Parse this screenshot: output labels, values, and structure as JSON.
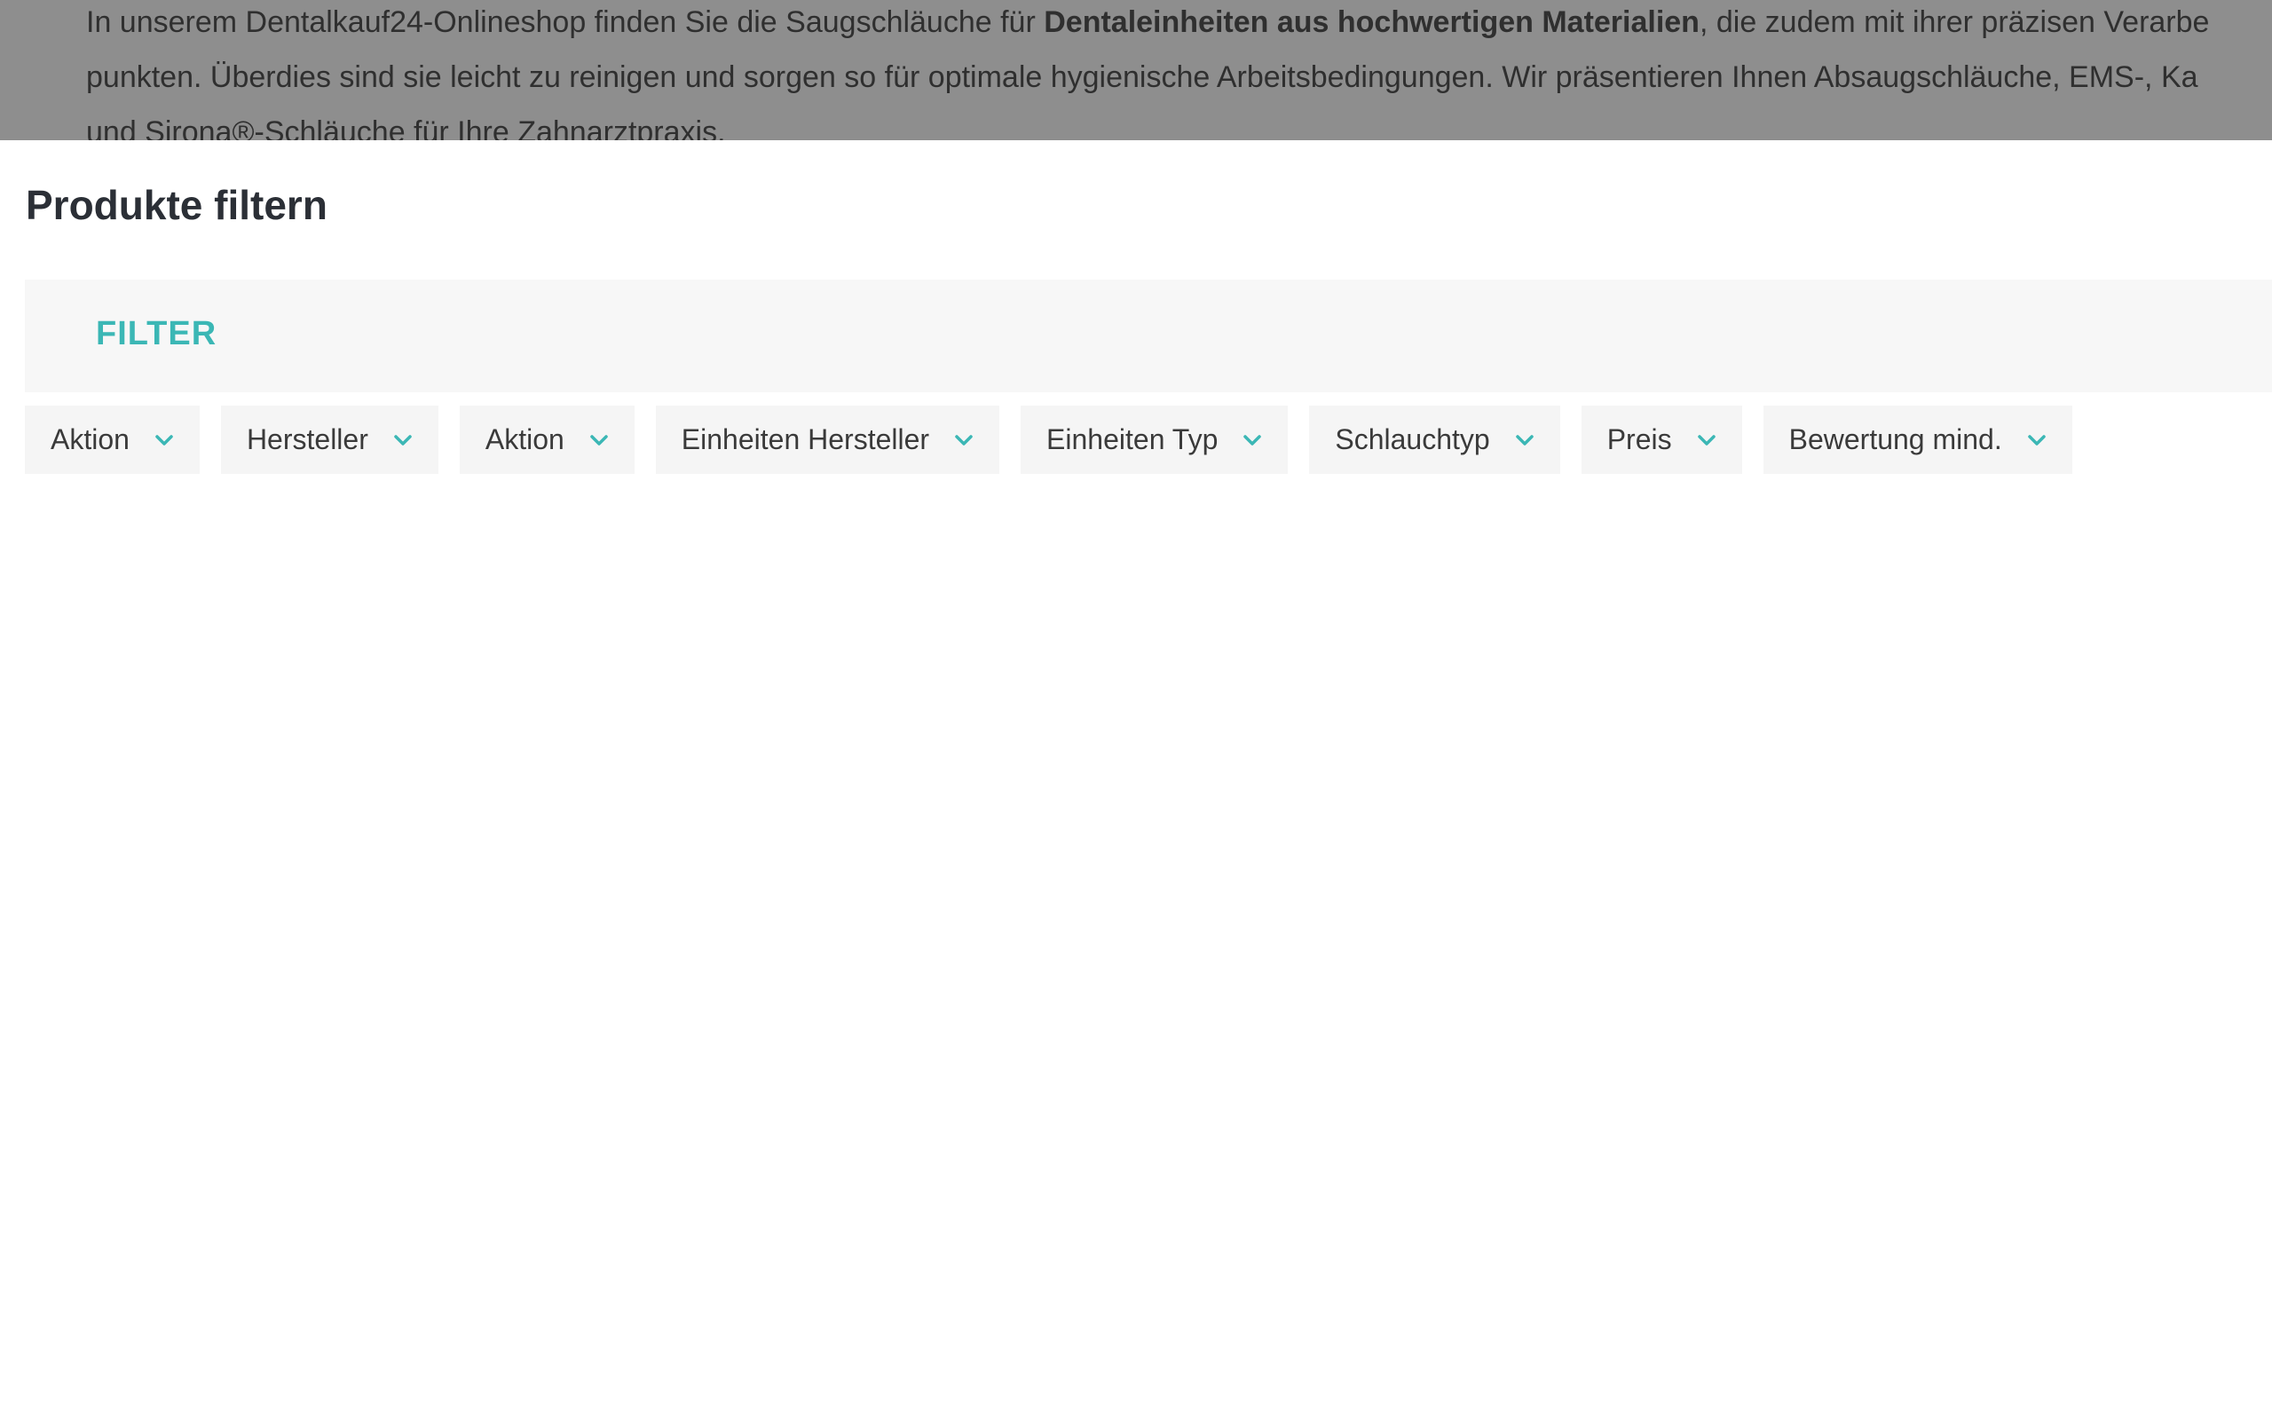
{
  "intro": {
    "line1_before": "In unserem Dentalkauf24-Onlineshop finden Sie die Saugschläuche für ",
    "line1_bold": "Dentaleinheiten aus hochwertigen Materialien",
    "line1_after": ", die zudem mit ihrer präzisen Verarbe",
    "line2": "punkten. Überdies sind sie leicht zu reinigen und sorgen so für optimale hygienische Arbeitsbedingungen. Wir präsentieren Ihnen Absaugschläuche, EMS-, Ka",
    "line3": "und Sirona®-Schläuche für Ihre Zahnarztpraxis."
  },
  "page_title": "Produkte filtern",
  "filter": {
    "label": "FILTER",
    "accent_color": "#3bb7b5",
    "chips": [
      {
        "label": "Aktion",
        "icon": "chevron-down-icon"
      },
      {
        "label": "Hersteller",
        "icon": "chevron-down-icon"
      },
      {
        "label": "Aktion",
        "icon": "chevron-down-icon"
      },
      {
        "label": "Einheiten Hersteller",
        "icon": "chevron-down-icon"
      },
      {
        "label": "Einheiten Typ",
        "icon": "chevron-down-icon"
      },
      {
        "label": "Schlauchtyp",
        "icon": "chevron-down-icon"
      },
      {
        "label": "Preis",
        "icon": "chevron-down-icon"
      },
      {
        "label": "Bewertung mind.",
        "icon": "chevron-down-icon"
      }
    ]
  }
}
